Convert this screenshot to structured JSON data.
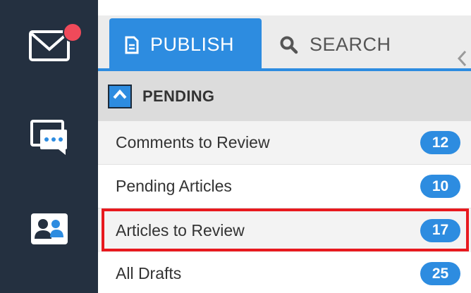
{
  "rail": {
    "items": [
      {
        "name": "mail",
        "icon": "mail-icon",
        "has_notification": true
      },
      {
        "name": "chat",
        "icon": "chat-icon"
      },
      {
        "name": "contacts",
        "icon": "contacts-icon"
      }
    ]
  },
  "tabs": [
    {
      "label": "PUBLISH",
      "icon": "document-icon",
      "active": true
    },
    {
      "label": "SEARCH",
      "icon": "search-icon",
      "active": false
    }
  ],
  "section": {
    "title": "PENDING",
    "expanded": true
  },
  "rows": [
    {
      "label": "Comments to Review",
      "count": "12"
    },
    {
      "label": "Pending Articles",
      "count": "10"
    },
    {
      "label": "Articles to Review",
      "count": "17",
      "highlighted": true
    },
    {
      "label": "All Drafts",
      "count": "25"
    }
  ],
  "colors": {
    "accent": "#2d8ce0",
    "rail": "#243040",
    "notification": "#f04a5a",
    "highlight": "#e8191e"
  }
}
